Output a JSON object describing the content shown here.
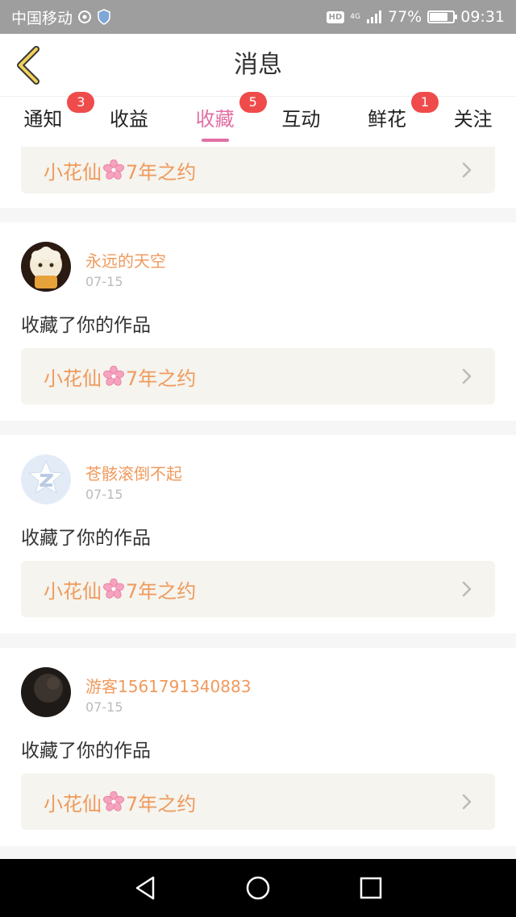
{
  "status_bar": {
    "carrier": "中国移动",
    "hd": "HD",
    "network": "4G",
    "battery": "77%",
    "battery_level": 0.77,
    "time": "09:31"
  },
  "header": {
    "title": "消息",
    "back_icon": "chevron-left-icon"
  },
  "tabs": [
    {
      "label": "通知",
      "badge": "3",
      "active": false
    },
    {
      "label": "收益",
      "badge": "",
      "active": false
    },
    {
      "label": "收藏",
      "badge": "5",
      "active": true
    },
    {
      "label": "互动",
      "badge": "",
      "active": false
    },
    {
      "label": "鲜花",
      "badge": "1",
      "active": false
    },
    {
      "label": "关注",
      "badge": "",
      "active": false
    }
  ],
  "work_title_prefix": "小花仙",
  "work_title_suffix": "7年之约",
  "messages": [
    {
      "user": "永远的天空",
      "date": "07-15",
      "text": "收藏了你的作品"
    },
    {
      "user": "苍骸滚倒不起",
      "date": "07-15",
      "text": "收藏了你的作品"
    },
    {
      "user": "游客1561791340883",
      "date": "07-15",
      "text": "收藏了你的作品"
    }
  ],
  "colors": {
    "accent": "#e26fa4",
    "badge": "#f04b4b",
    "username": "#ef9a5d",
    "link_bg": "#f5f4ee"
  },
  "nav": {
    "back": "triangle-back-icon",
    "home": "circle-home-icon",
    "recent": "square-recent-icon"
  }
}
